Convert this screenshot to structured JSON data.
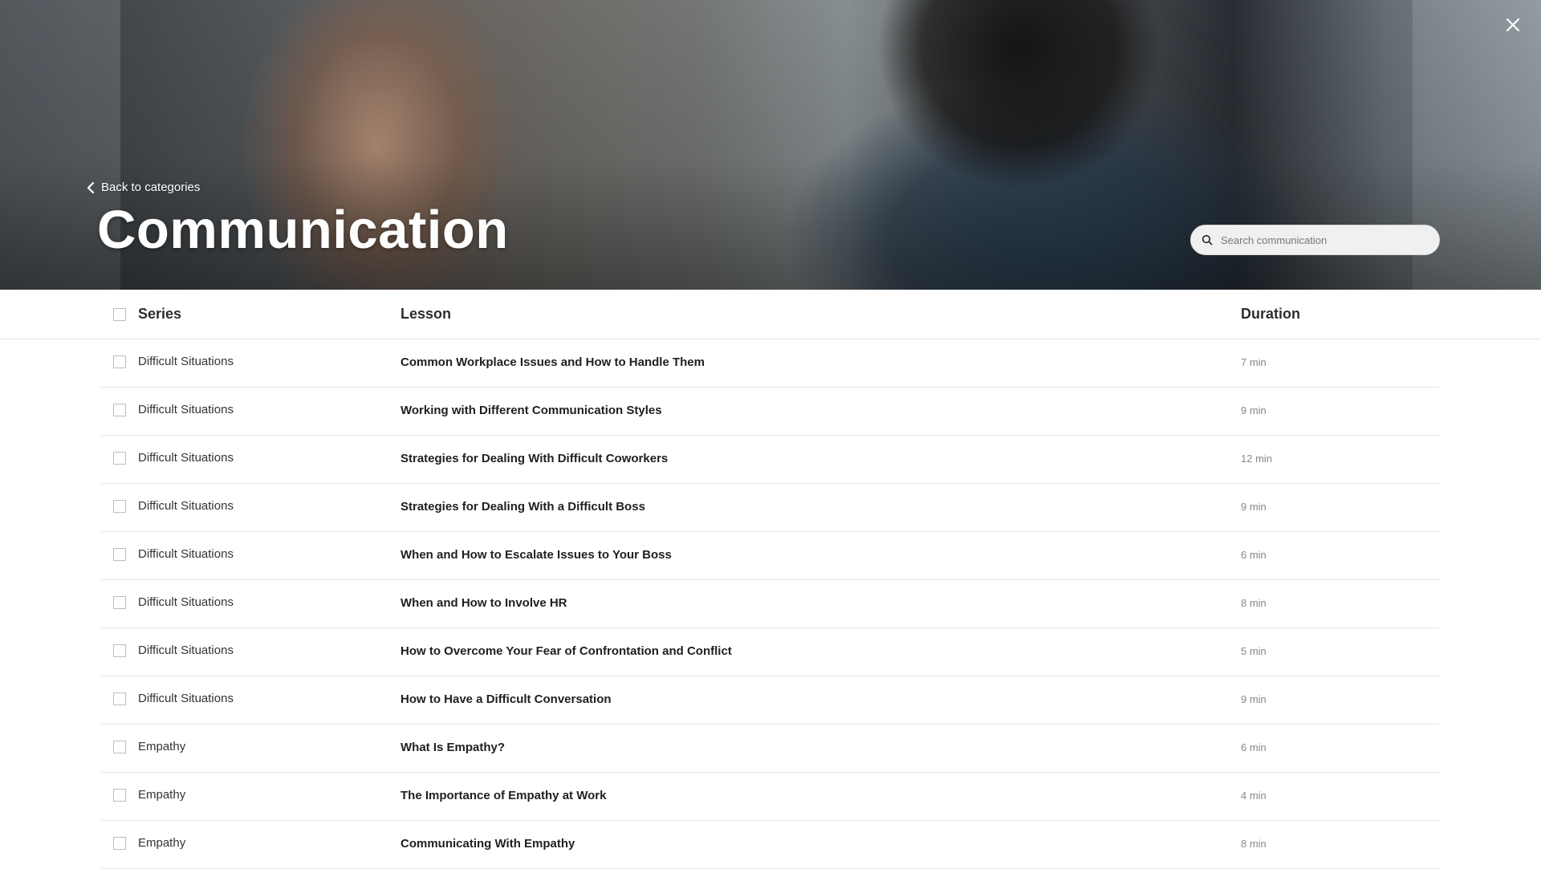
{
  "hero": {
    "back_label": "Back to categories",
    "title": "Communication",
    "search_placeholder": "Search communication"
  },
  "table": {
    "columns": {
      "series": "Series",
      "lesson": "Lesson",
      "duration": "Duration"
    },
    "rows": [
      {
        "series": "Difficult Situations",
        "lesson": "Common Workplace Issues and How to Handle Them",
        "duration": "7 min"
      },
      {
        "series": "Difficult Situations",
        "lesson": "Working with Different Communication Styles",
        "duration": "9 min"
      },
      {
        "series": "Difficult Situations",
        "lesson": "Strategies for Dealing With Difficult Coworkers",
        "duration": "12 min"
      },
      {
        "series": "Difficult Situations",
        "lesson": "Strategies for Dealing With a Difficult Boss",
        "duration": "9 min"
      },
      {
        "series": "Difficult Situations",
        "lesson": "When and How to Escalate Issues to Your Boss",
        "duration": "6 min"
      },
      {
        "series": "Difficult Situations",
        "lesson": "When and How to Involve HR",
        "duration": "8 min"
      },
      {
        "series": "Difficult Situations",
        "lesson": "How to Overcome Your Fear of Confrontation and Conflict",
        "duration": "5 min"
      },
      {
        "series": "Difficult Situations",
        "lesson": "How to Have a Difficult Conversation",
        "duration": "9 min"
      },
      {
        "series": "Empathy",
        "lesson": "What Is Empathy?",
        "duration": "6 min"
      },
      {
        "series": "Empathy",
        "lesson": "The Importance of Empathy at Work",
        "duration": "4 min"
      },
      {
        "series": "Empathy",
        "lesson": "Communicating With Empathy",
        "duration": "8 min"
      }
    ]
  }
}
